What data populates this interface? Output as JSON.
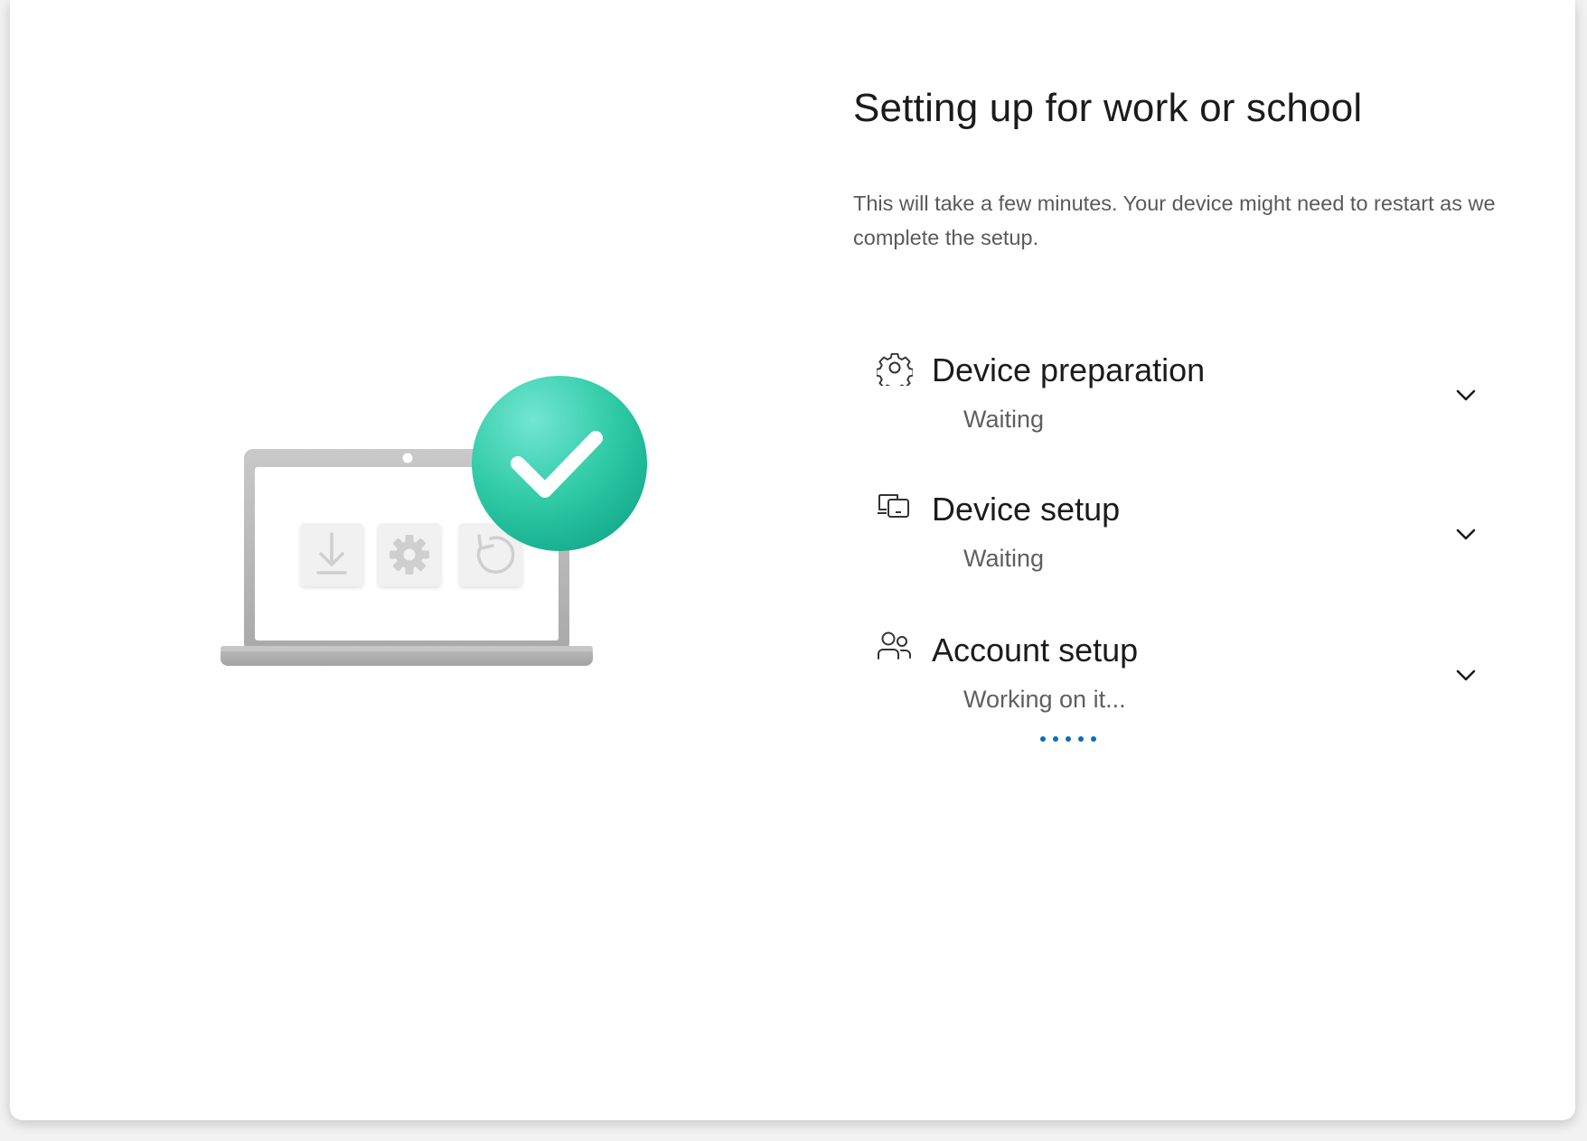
{
  "page": {
    "title": "Setting up for work or school",
    "description": "This will take a few minutes. Your device might need to restart as we complete the setup."
  },
  "colors": {
    "accent": "#0f6cbd",
    "check_circle": "#2fcaa6",
    "text_primary": "#1b1b1b",
    "text_secondary": "#5f5f5f"
  },
  "steps": [
    {
      "icon": "gear-icon",
      "label": "Device preparation",
      "status": "Waiting",
      "expanded": false
    },
    {
      "icon": "devices-icon",
      "label": "Device setup",
      "status": "Waiting",
      "expanded": false
    },
    {
      "icon": "people-icon",
      "label": "Account setup",
      "status": "Working on it...",
      "expanded": false,
      "in_progress": true
    }
  ]
}
